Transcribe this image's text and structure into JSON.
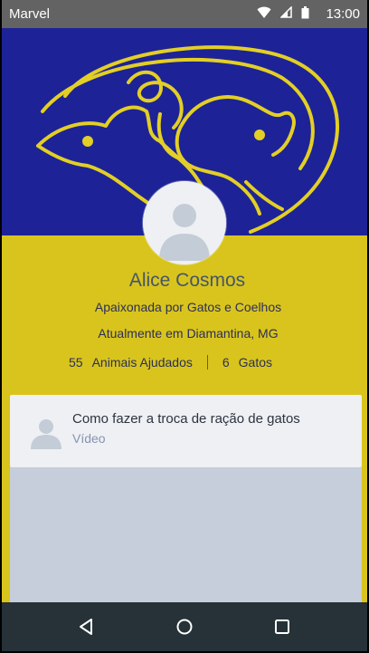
{
  "status_bar": {
    "carrier": "Marvel",
    "time": "13:00",
    "icons": [
      "wifi-icon",
      "signal-icon",
      "battery-icon"
    ]
  },
  "profile": {
    "name": "Alice Cosmos",
    "bio": "Apaixonada por Gatos e Coelhos",
    "location": "Atualmente em Diamantina, MG",
    "stats": [
      {
        "value": "55",
        "label": "Animais Ajudados"
      },
      {
        "value": "6",
        "label": "Gatos"
      }
    ]
  },
  "card": {
    "title": "Como fazer a troca de ração de gatos",
    "subtitle": "Vídeo"
  },
  "nav": {
    "buttons": [
      "back-icon",
      "home-icon",
      "recents-icon"
    ]
  },
  "colors": {
    "cover_bg": "#1d2396",
    "page_bg": "#d9c41d",
    "logo_stroke": "#e3cf25",
    "nav_bg": "#263238",
    "status_bg": "#636363"
  }
}
